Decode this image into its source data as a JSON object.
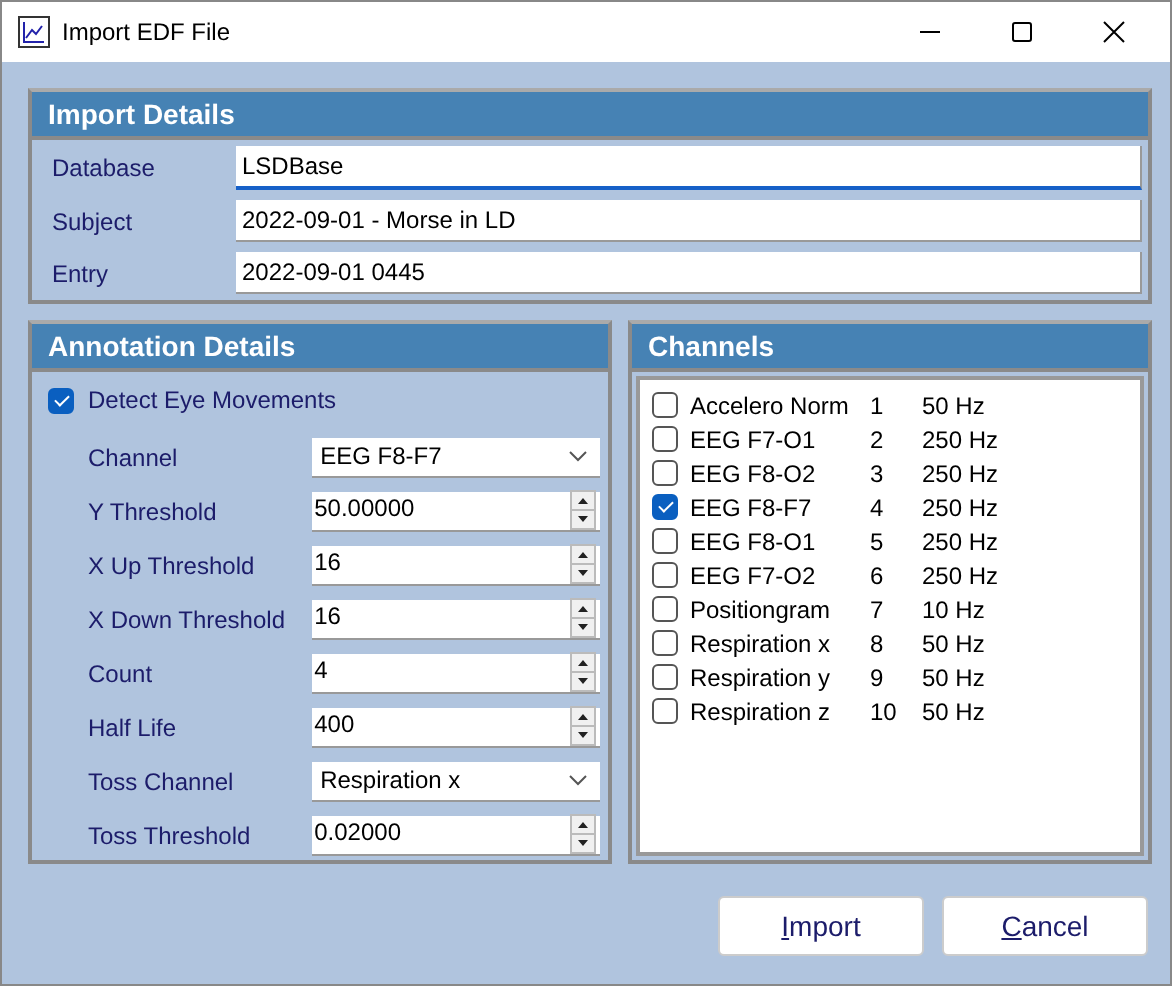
{
  "window": {
    "title": "Import EDF File"
  },
  "import_details": {
    "title": "Import Details",
    "fields": [
      {
        "label": "Database",
        "value": "LSDBase",
        "focused": true
      },
      {
        "label": "Subject",
        "value": "2022-09-01 - Morse in LD",
        "focused": false
      },
      {
        "label": "Entry",
        "value": "2022-09-01 0445",
        "focused": false
      }
    ]
  },
  "annotation_details": {
    "title": "Annotation Details",
    "detect": {
      "label": "Detect Eye Movements",
      "checked": true
    },
    "fields": [
      {
        "label": "Channel",
        "value": "EEG F8-F7",
        "kind": "dropdown"
      },
      {
        "label": "Y Threshold",
        "value": "50.00000",
        "kind": "spin"
      },
      {
        "label": "X Up Threshold",
        "value": "16",
        "kind": "spin"
      },
      {
        "label": "X Down Threshold",
        "value": "16",
        "kind": "spin"
      },
      {
        "label": "Count",
        "value": "4",
        "kind": "spin"
      },
      {
        "label": "Half Life",
        "value": "400",
        "kind": "spin"
      },
      {
        "label": "Toss Channel",
        "value": "Respiration x",
        "kind": "dropdown"
      },
      {
        "label": "Toss Threshold",
        "value": "0.02000",
        "kind": "spin"
      }
    ]
  },
  "channels": {
    "title": "Channels",
    "items": [
      {
        "name": "Accelero Norm",
        "number": "1",
        "rate": "50 Hz",
        "checked": false
      },
      {
        "name": "EEG F7-O1",
        "number": "2",
        "rate": "250 Hz",
        "checked": false
      },
      {
        "name": "EEG F8-O2",
        "number": "3",
        "rate": "250 Hz",
        "checked": false
      },
      {
        "name": "EEG F8-F7",
        "number": "4",
        "rate": "250 Hz",
        "checked": true
      },
      {
        "name": "EEG F8-O1",
        "number": "5",
        "rate": "250 Hz",
        "checked": false
      },
      {
        "name": "EEG F7-O2",
        "number": "6",
        "rate": "250 Hz",
        "checked": false
      },
      {
        "name": "Positiongram",
        "number": "7",
        "rate": "10 Hz",
        "checked": false
      },
      {
        "name": "Respiration x",
        "number": "8",
        "rate": "50 Hz",
        "checked": false
      },
      {
        "name": "Respiration y",
        "number": "9",
        "rate": "50 Hz",
        "checked": false
      },
      {
        "name": "Respiration z",
        "number": "10",
        "rate": "50 Hz",
        "checked": false
      }
    ]
  },
  "buttons": [
    {
      "label": "Import",
      "mnemonic_first_letter": true
    },
    {
      "label": "Cancel",
      "mnemonic_first_letter": true
    }
  ]
}
